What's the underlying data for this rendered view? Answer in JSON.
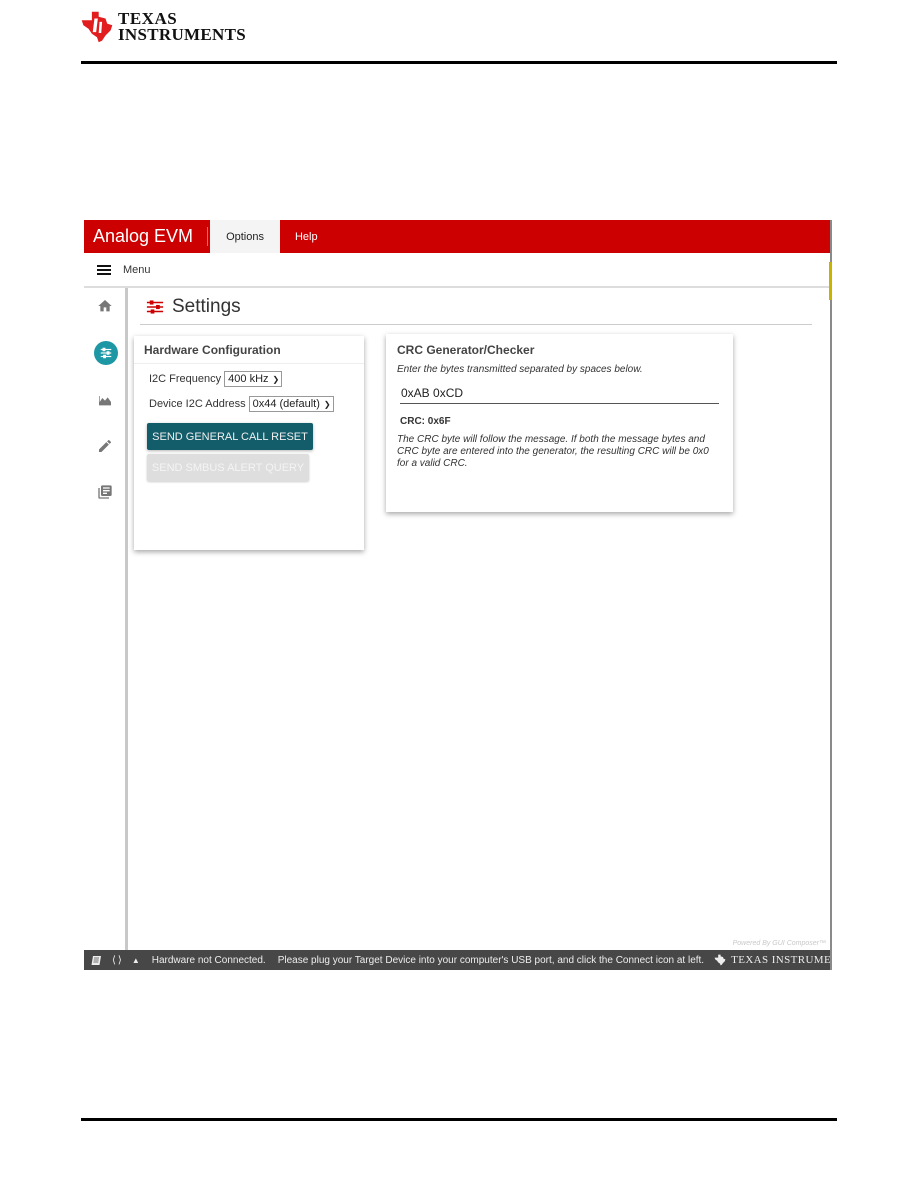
{
  "header": {
    "brand_line1": "Texas",
    "brand_line2": "Instruments"
  },
  "app": {
    "title": "Analog EVM",
    "tabs": [
      {
        "label": "Options",
        "active": true
      },
      {
        "label": "Help",
        "active": false
      }
    ],
    "menu_label": "Menu",
    "accent_color": "#cc0000",
    "sidebar": {
      "items": [
        {
          "icon": "home-icon"
        },
        {
          "icon": "settings-sliders-icon",
          "active": true
        },
        {
          "icon": "area-chart-icon"
        },
        {
          "icon": "pencil-icon"
        },
        {
          "icon": "library-books-icon"
        }
      ]
    },
    "page_title": "Settings",
    "hardware_config": {
      "title": "Hardware Configuration",
      "i2c_frequency_label": "I2C Frequency",
      "i2c_frequency_value": "400 kHz",
      "device_address_label": "Device I2C Address",
      "device_address_value": "0x44 (default)",
      "general_call_button": "SEND GENERAL CALL RESET",
      "smbus_alert_button": "SEND SMBUS ALERT QUERY"
    },
    "crc": {
      "title": "CRC Generator/Checker",
      "hint": "Enter the bytes transmitted separated by spaces below.",
      "input_value": "0xAB 0xCD",
      "result": "CRC: 0x6F",
      "note": "The CRC byte will follow the message. If both the message bytes and CRC byte are entered into the generator, the resulting CRC will be 0x0 for a valid CRC."
    },
    "powered_by": "Powered By GUI Composer™",
    "statusbar": {
      "status": "Hardware not Connected.",
      "message": "Please plug your Target Device into your computer's USB port, and click the Connect icon at left.",
      "brand": "Texas Instruments"
    }
  }
}
